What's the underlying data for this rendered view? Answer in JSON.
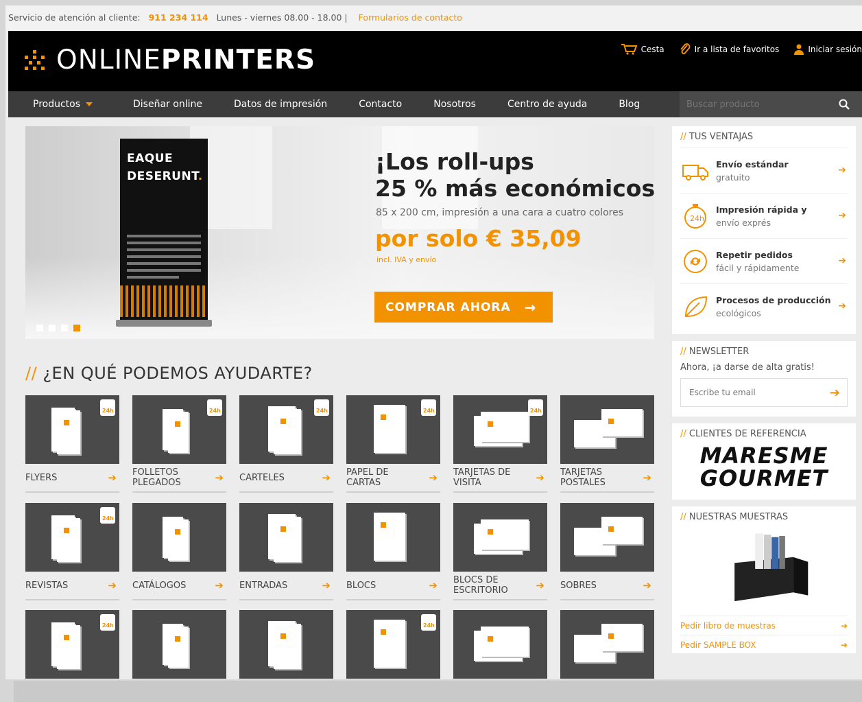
{
  "topbar": {
    "service_label": "Servicio de atención al cliente:",
    "phone": "911 234 114",
    "hours": "Lunes - viernes 08.00 - 18.00  |",
    "contact_link": "Formularios de contacto"
  },
  "header": {
    "logo_light": "ONLINE",
    "logo_bold": "PRINTERS",
    "cart": "Cesta",
    "favorites": "Ir a lista de favoritos",
    "login": "Iniciar sesión"
  },
  "nav": {
    "items": [
      "Productos",
      "Diseñar online",
      "Datos de impresión",
      "Contacto",
      "Nosotros",
      "Centro de ayuda",
      "Blog"
    ],
    "search_placeholder": "Buscar producto"
  },
  "banner": {
    "rollup_line1": "EAQUE",
    "rollup_line2": "DESERUNT",
    "headline_1": "¡Los roll-ups",
    "headline_2": "25 % más económicos!",
    "subtitle": "85 x 200 cm, impresión a una cara a cuatro colores",
    "price": "por solo € 35,09",
    "fine_print": "incl. IVA y envío",
    "button": "COMPRAR AHORA",
    "slides": 4,
    "active_slide": 4
  },
  "help": {
    "prefix": "//",
    "title": "¿EN QUÉ PODEMOS AYUDARTE?"
  },
  "products": [
    {
      "label": "FLYERS",
      "badge": "24h"
    },
    {
      "label": "FOLLETOS PLEGADOS",
      "badge": "24h"
    },
    {
      "label": "CARTELES",
      "badge": "24h"
    },
    {
      "label": "PAPEL DE CARTAS",
      "badge": "24h"
    },
    {
      "label": "TARJETAS DE VISITA",
      "badge": "24h"
    },
    {
      "label": "TARJETAS POSTALES",
      "badge": ""
    },
    {
      "label": "REVISTAS",
      "badge": "24h"
    },
    {
      "label": "CATÁLOGOS",
      "badge": ""
    },
    {
      "label": "ENTRADAS",
      "badge": ""
    },
    {
      "label": "BLOCS",
      "badge": ""
    },
    {
      "label": "BLOCS DE ESCRITORIO",
      "badge": ""
    },
    {
      "label": "SOBRES",
      "badge": ""
    },
    {
      "label": "",
      "badge": "24h"
    },
    {
      "label": "",
      "badge": ""
    },
    {
      "label": "",
      "badge": ""
    },
    {
      "label": "",
      "badge": "24h"
    },
    {
      "label": "",
      "badge": ""
    },
    {
      "label": "",
      "badge": ""
    }
  ],
  "sidebar": {
    "advantages_title": "TUS VENTAJAS",
    "advantages": [
      {
        "bold": "Envío estándar",
        "text": "gratuito",
        "icon": "truck-icon"
      },
      {
        "bold": "Impresión rápida y",
        "text": "envío exprés",
        "icon": "24h-clock-icon"
      },
      {
        "bold": "Repetir pedidos",
        "text": "fácil y rápidamente",
        "icon": "repeat-icon"
      },
      {
        "bold": "Procesos de producción",
        "text": "ecológicos",
        "icon": "leaf-icon"
      }
    ],
    "newsletter_title": "NEWSLETTER",
    "newsletter_text": "Ahora, ¡a darse de alta gratis!",
    "newsletter_placeholder": "Escribe tu email",
    "clients_title": "CLIENTES DE REFERENCIA",
    "client_logo_1": "MARESME",
    "client_logo_2": "GOURMET",
    "samples_title": "NUESTRAS MUESTRAS",
    "sample_link_1": "Pedir libro de muestras",
    "sample_link_2": "Pedir SAMPLE BOX"
  },
  "colors": {
    "accent": "#f39200",
    "header_bg": "#000000",
    "nav_bg": "#3c3c3c",
    "tile_bg": "#4a4a4a"
  }
}
